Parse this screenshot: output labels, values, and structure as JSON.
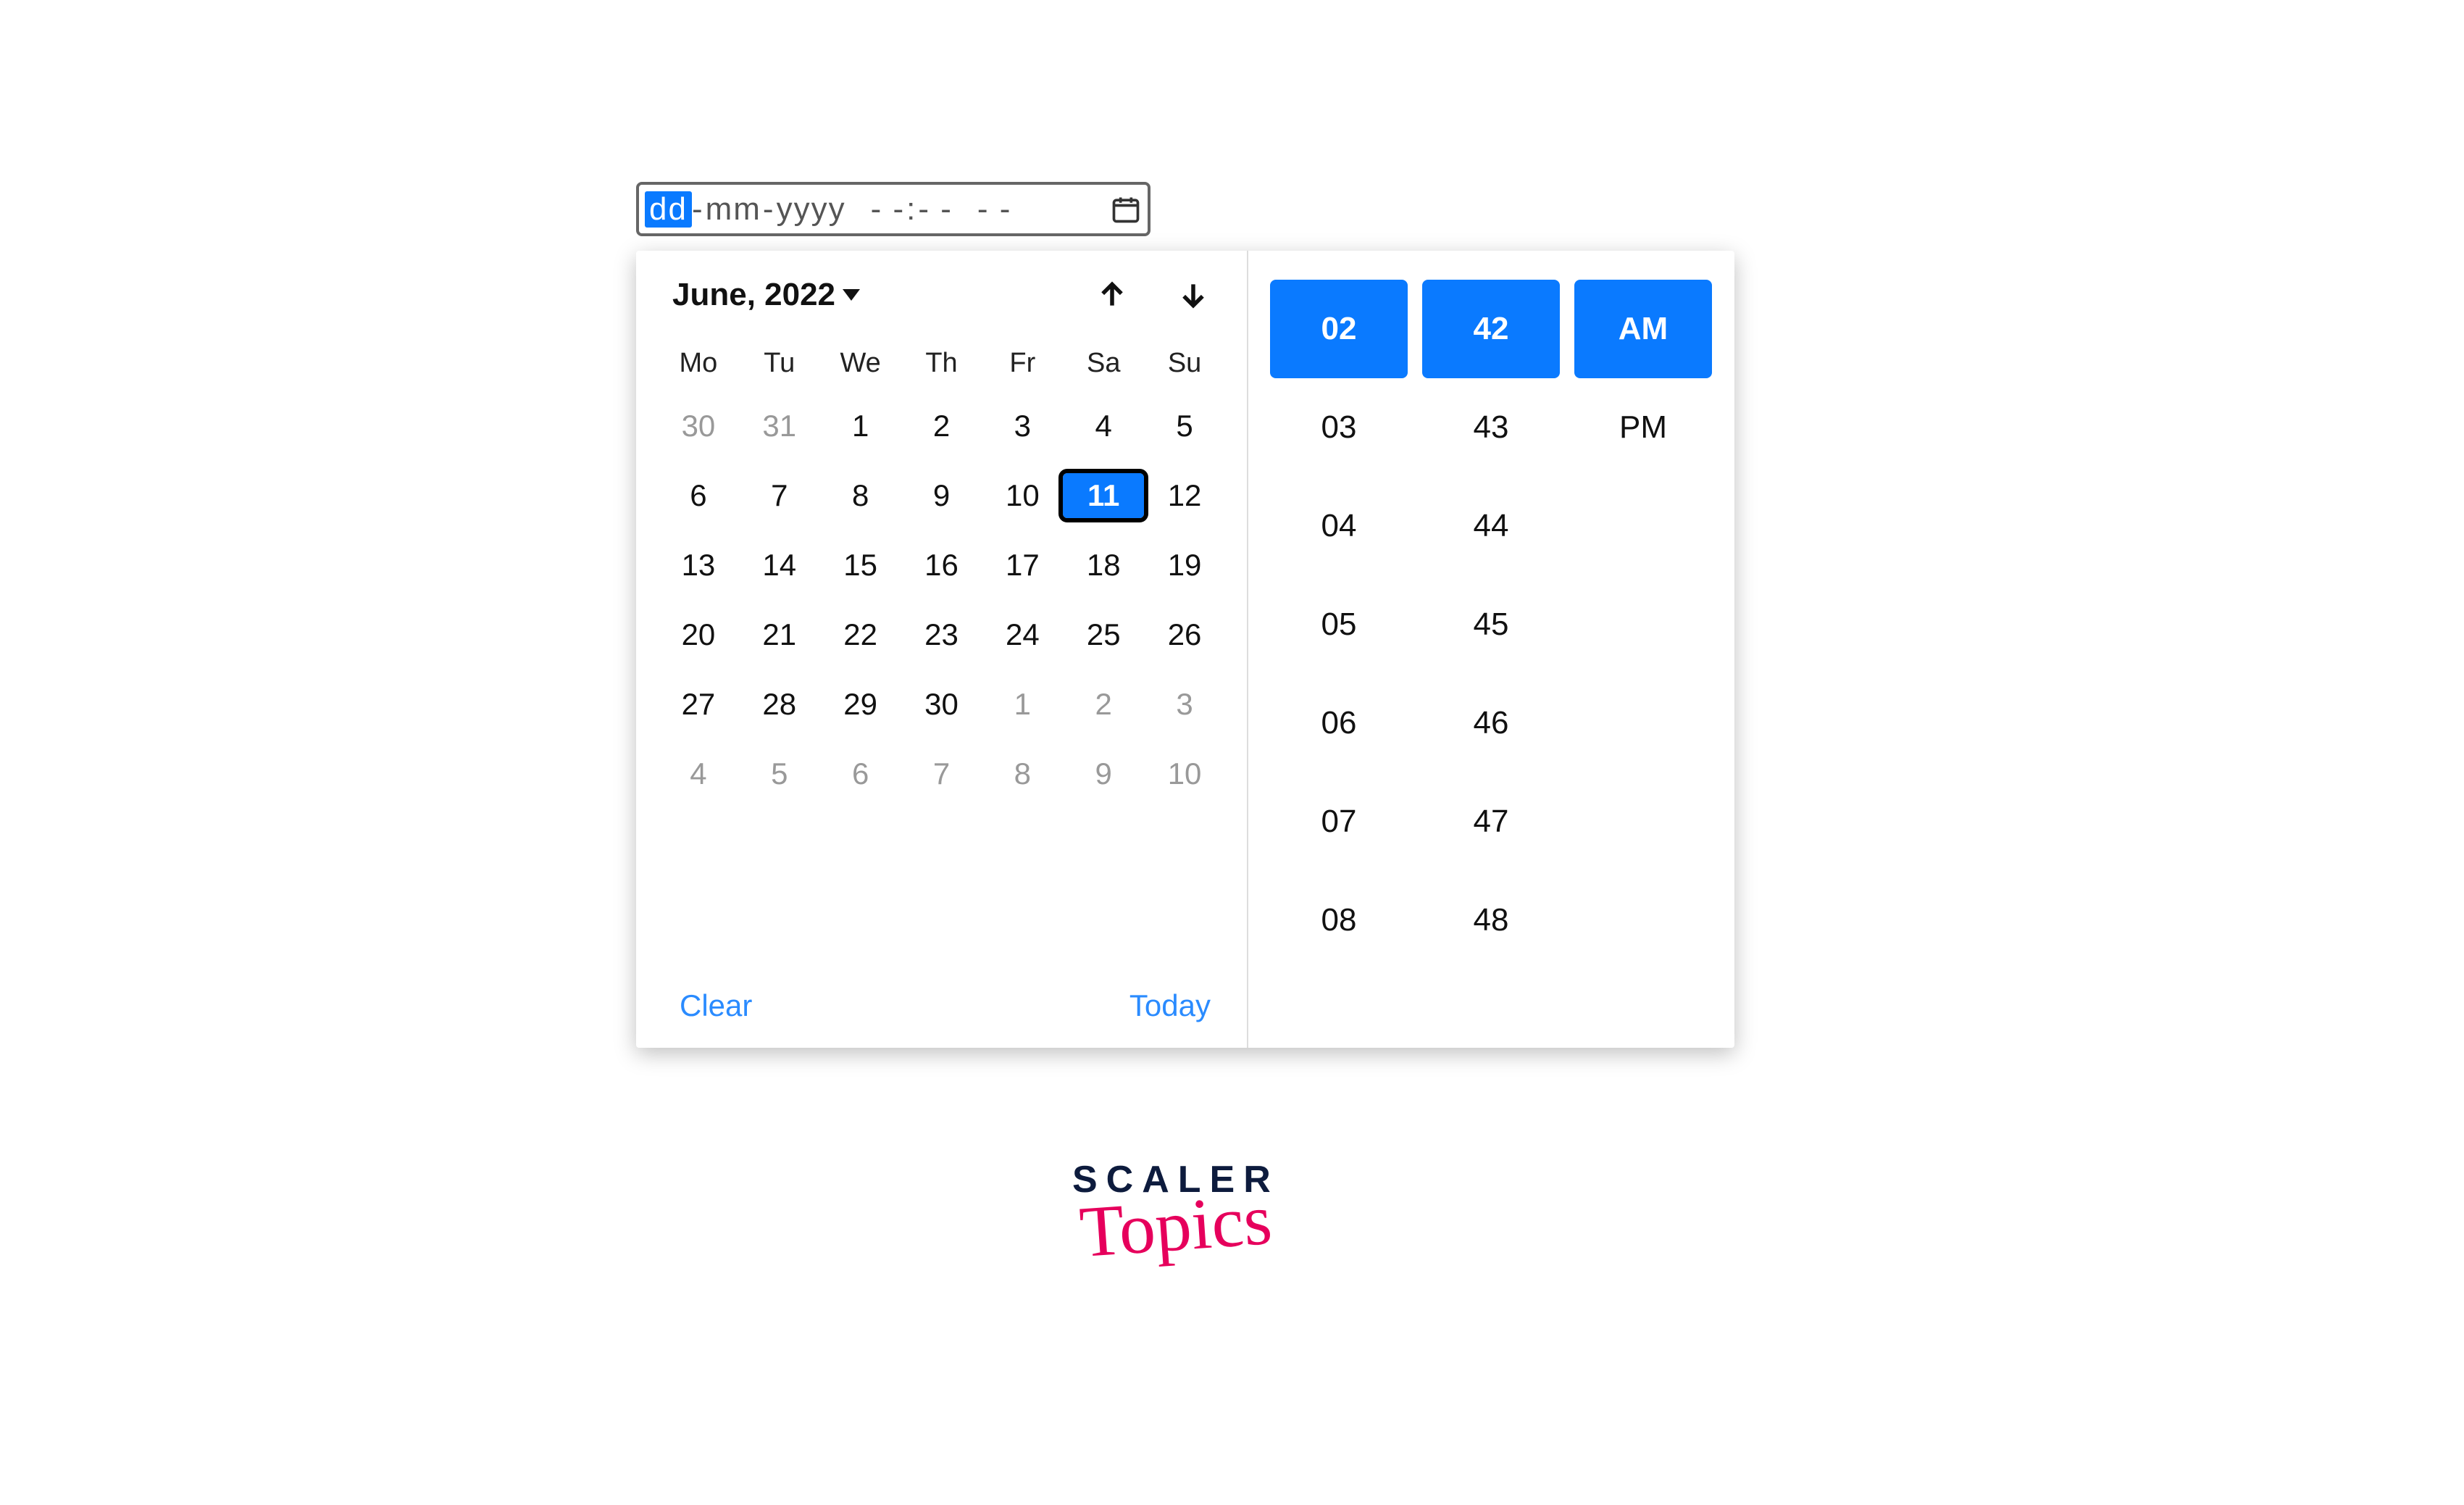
{
  "input": {
    "dd": "dd",
    "mm": "mm",
    "yyyy": "yyyy",
    "hh": "- -",
    "min": "- -",
    "ampm": "- -"
  },
  "calendar": {
    "month_label": "June, 2022",
    "weekdays": [
      "Mo",
      "Tu",
      "We",
      "Th",
      "Fr",
      "Sa",
      "Su"
    ],
    "cells": [
      {
        "n": "30",
        "muted": true
      },
      {
        "n": "31",
        "muted": true
      },
      {
        "n": "1"
      },
      {
        "n": "2"
      },
      {
        "n": "3"
      },
      {
        "n": "4"
      },
      {
        "n": "5"
      },
      {
        "n": "6"
      },
      {
        "n": "7"
      },
      {
        "n": "8"
      },
      {
        "n": "9"
      },
      {
        "n": "10"
      },
      {
        "n": "11",
        "selected": true
      },
      {
        "n": "12"
      },
      {
        "n": "13"
      },
      {
        "n": "14"
      },
      {
        "n": "15"
      },
      {
        "n": "16"
      },
      {
        "n": "17"
      },
      {
        "n": "18"
      },
      {
        "n": "19"
      },
      {
        "n": "20"
      },
      {
        "n": "21"
      },
      {
        "n": "22"
      },
      {
        "n": "23"
      },
      {
        "n": "24"
      },
      {
        "n": "25"
      },
      {
        "n": "26"
      },
      {
        "n": "27"
      },
      {
        "n": "28"
      },
      {
        "n": "29"
      },
      {
        "n": "30"
      },
      {
        "n": "1",
        "muted": true
      },
      {
        "n": "2",
        "muted": true
      },
      {
        "n": "3",
        "muted": true
      },
      {
        "n": "4",
        "muted": true
      },
      {
        "n": "5",
        "muted": true
      },
      {
        "n": "6",
        "muted": true
      },
      {
        "n": "7",
        "muted": true
      },
      {
        "n": "8",
        "muted": true
      },
      {
        "n": "9",
        "muted": true
      },
      {
        "n": "10",
        "muted": true
      }
    ],
    "clear_label": "Clear",
    "today_label": "Today"
  },
  "time": {
    "hours": [
      {
        "v": "02",
        "selected": true
      },
      {
        "v": "03"
      },
      {
        "v": "04"
      },
      {
        "v": "05"
      },
      {
        "v": "06"
      },
      {
        "v": "07"
      },
      {
        "v": "08"
      }
    ],
    "minutes": [
      {
        "v": "42",
        "selected": true
      },
      {
        "v": "43"
      },
      {
        "v": "44"
      },
      {
        "v": "45"
      },
      {
        "v": "46"
      },
      {
        "v": "47"
      },
      {
        "v": "48"
      }
    ],
    "ampm": [
      {
        "v": "AM",
        "selected": true
      },
      {
        "v": "PM"
      }
    ]
  },
  "logo": {
    "line1": "SCALER",
    "line2": "Topics"
  }
}
